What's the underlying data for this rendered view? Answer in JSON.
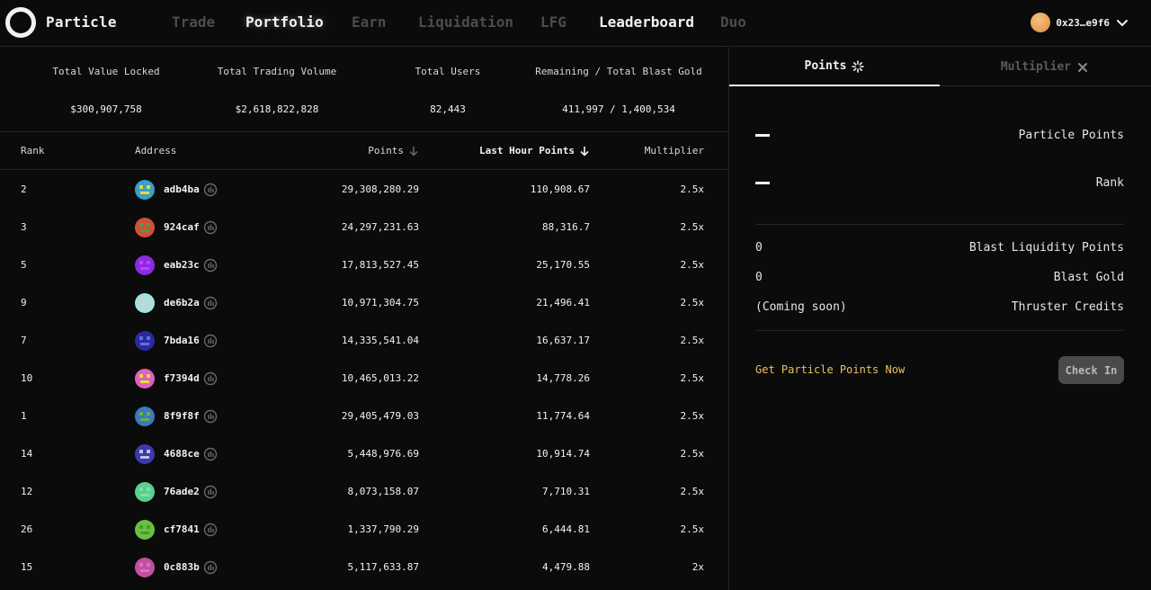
{
  "brand": {
    "name": "Particle"
  },
  "nav": [
    {
      "label": "Trade",
      "state": "dim"
    },
    {
      "label": "Portfolio",
      "state": "glow"
    },
    {
      "label": "Earn",
      "state": "dim"
    },
    {
      "label": "Liquidation",
      "state": "dim"
    },
    {
      "label": "LFG",
      "state": "dim"
    },
    {
      "label": "Leaderboard",
      "state": "active"
    },
    {
      "label": "Duo",
      "state": "dim"
    }
  ],
  "account": {
    "address": "0x23…e9f6"
  },
  "stats": [
    {
      "label": "Total Value Locked",
      "value": "$300,907,758"
    },
    {
      "label": "Total Trading Volume",
      "value": "$2,618,822,828"
    },
    {
      "label": "Total Users",
      "value": "82,443"
    },
    {
      "label": "Remaining / Total Blast Gold",
      "value": "411,997 / 1,400,534"
    }
  ],
  "table": {
    "headers": {
      "rank": "Rank",
      "address": "Address",
      "points": "Points",
      "last_hour": "Last Hour Points",
      "multiplier": "Multiplier"
    },
    "rows": [
      {
        "rank": "2",
        "address": "adb4ba",
        "points": "29,308,280.29",
        "last_hour": "110,908.67",
        "multiplier": "2.5x",
        "avatar": [
          "#3ba0c8",
          "#e0d84a"
        ]
      },
      {
        "rank": "3",
        "address": "924caf",
        "points": "24,297,231.63",
        "last_hour": "88,316.7",
        "multiplier": "2.5x",
        "avatar": [
          "#d0503a",
          "#4aa04a"
        ]
      },
      {
        "rank": "5",
        "address": "eab23c",
        "points": "17,813,527.45",
        "last_hour": "25,170.55",
        "multiplier": "2.5x",
        "avatar": [
          "#8a2be2",
          "#c040ff"
        ]
      },
      {
        "rank": "9",
        "address": "de6b2a",
        "points": "10,971,304.75",
        "last_hour": "21,496.41",
        "multiplier": "2.5x",
        "avatar": [
          "#9ee6e0",
          "#f0c0c0"
        ]
      },
      {
        "rank": "7",
        "address": "7bda16",
        "points": "14,335,541.04",
        "last_hour": "16,637.17",
        "multiplier": "2.5x",
        "avatar": [
          "#2a2aa0",
          "#6a6ae0"
        ]
      },
      {
        "rank": "10",
        "address": "f7394d",
        "points": "10,465,013.22",
        "last_hour": "14,778.26",
        "multiplier": "2.5x",
        "avatar": [
          "#e060c0",
          "#e0e040"
        ]
      },
      {
        "rank": "1",
        "address": "8f9f8f",
        "points": "29,405,479.03",
        "last_hour": "11,774.64",
        "multiplier": "2.5x",
        "avatar": [
          "#3a7ac0",
          "#6ab04a"
        ]
      },
      {
        "rank": "14",
        "address": "4688ce",
        "points": "5,448,976.69",
        "last_hour": "10,914.74",
        "multiplier": "2.5x",
        "avatar": [
          "#3a3ab0",
          "#c0c0e0"
        ]
      },
      {
        "rank": "12",
        "address": "76ade2",
        "points": "8,073,158.07",
        "last_hour": "7,710.31",
        "multiplier": "2.5x",
        "avatar": [
          "#5ad090",
          "#80e0a0"
        ]
      },
      {
        "rank": "26",
        "address": "cf7841",
        "points": "1,337,790.29",
        "last_hour": "6,444.81",
        "multiplier": "2.5x",
        "avatar": [
          "#6ac040",
          "#4a9a30"
        ]
      },
      {
        "rank": "15",
        "address": "0c883b",
        "points": "5,117,633.87",
        "last_hour": "4,479.88",
        "multiplier": "2x",
        "avatar": [
          "#c050a0",
          "#e070c0"
        ]
      }
    ]
  },
  "side": {
    "tabs": {
      "points": "Points",
      "multiplier": "Multiplier"
    },
    "particle_points_label": "Particle Points",
    "rank_label": "Rank",
    "kv": [
      {
        "key": "0",
        "label": "Blast Liquidity Points"
      },
      {
        "key": "0",
        "label": "Blast Gold"
      },
      {
        "key": "(Coming soon)",
        "label": "Thruster Credits"
      }
    ],
    "cta": "Get Particle Points Now",
    "checkin": "Check In"
  },
  "colors": {
    "background": "#0b0b0b",
    "accent_gold": "#e8c15c",
    "divider": "#262626"
  },
  "icons": [
    "logo-ring-icon",
    "chevron-down-icon",
    "sort-arrow-icon",
    "explorer-link-icon",
    "sparkle-icon",
    "close-icon"
  ]
}
